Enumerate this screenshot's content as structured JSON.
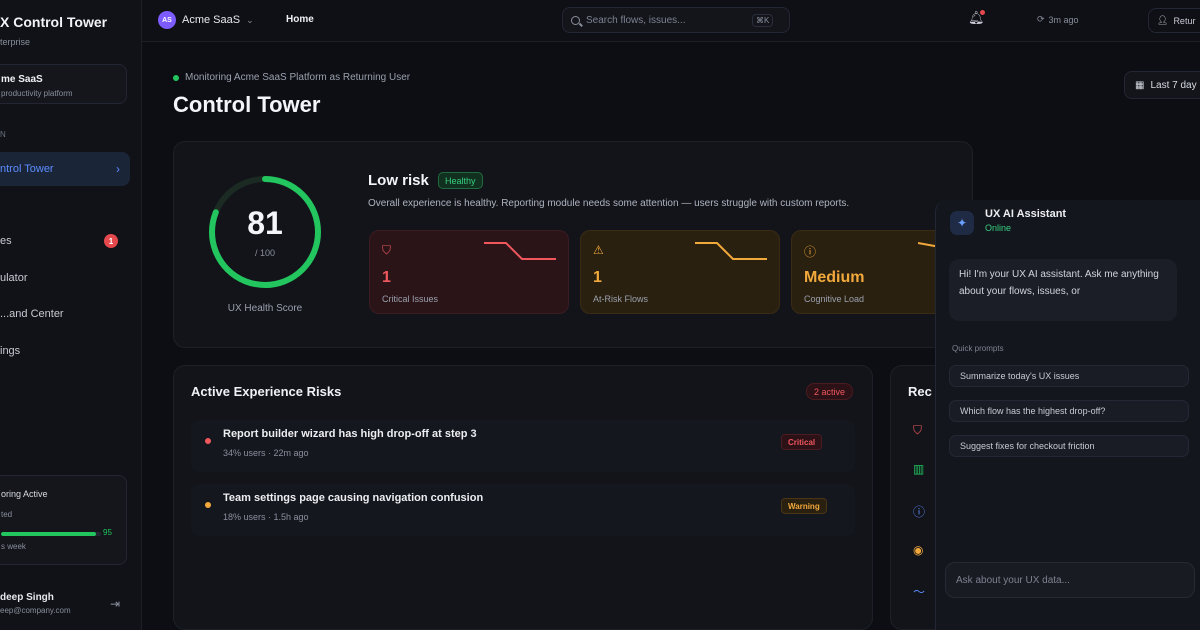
{
  "sidebar": {
    "brand_title": "X Control Tower",
    "brand_sub": "terprise",
    "workspace_name": "me SaaS",
    "workspace_sub": "productivity platform",
    "section": "N",
    "items": [
      {
        "label": "ntrol Tower",
        "active": true
      },
      {
        "label": "es",
        "badge": "1"
      },
      {
        "label": "ulator"
      },
      {
        "label": "...and Center"
      },
      {
        "label": "ings"
      }
    ],
    "monitoring": {
      "title": "oring Active",
      "sub": "ted",
      "progress": 0.95,
      "pct": "95",
      "week": "s week"
    },
    "user_name": "deep Singh",
    "user_email": "eep@company.com"
  },
  "topbar": {
    "org_initials": "AS",
    "org_name": "Acme SaaS",
    "home": "Home",
    "search_placeholder": "Search flows, issues...",
    "search_kbd": "⌘K",
    "refreshed": "3m ago",
    "user_button": "Retur"
  },
  "main": {
    "monitoring_text": "Monitoring Acme SaaS Platform as Returning User",
    "title": "Control Tower",
    "date_range": "Last 7 day",
    "health": {
      "score": "81",
      "score_value": 81,
      "max": "/ 100",
      "label": "UX Health Score",
      "risk_level": "Low risk",
      "badge": "Healthy",
      "summary": "Overall experience is healthy. Reporting module needs some attention — users struggle with custom reports."
    },
    "kpis": [
      {
        "value": "1",
        "label": "Critical Issues",
        "tone": "red"
      },
      {
        "value": "1",
        "label": "At-Risk Flows",
        "tone": "amber"
      },
      {
        "value": "Medium",
        "label": "Cognitive Load",
        "tone": "amber"
      }
    ],
    "risks": {
      "title": "Active Experience Risks",
      "active_count": "2 active",
      "items": [
        {
          "text": "Report builder wizard has high drop-off at step 3",
          "meta": "34% users · 22m ago",
          "severity": "Critical"
        },
        {
          "text": "Team settings page causing navigation confusion",
          "meta": "18% users · 1.5h ago",
          "severity": "Warning"
        }
      ]
    },
    "recommendations_title": "Rec"
  },
  "assistant": {
    "name": "UX AI Assistant",
    "status": "Online",
    "greeting": "Hi! I'm your UX AI assistant. Ask me anything about your flows, issues, or",
    "quick_label": "Quick prompts",
    "prompts": [
      "Summarize today's UX issues",
      "Which flow has the highest drop-off?",
      "Suggest fixes for checkout friction"
    ],
    "input_placeholder": "Ask about your UX data..."
  },
  "colors": {
    "accent": "#5b8cff",
    "success": "#22c55e",
    "critical": "#f0575d",
    "warning": "#f2a93b"
  }
}
